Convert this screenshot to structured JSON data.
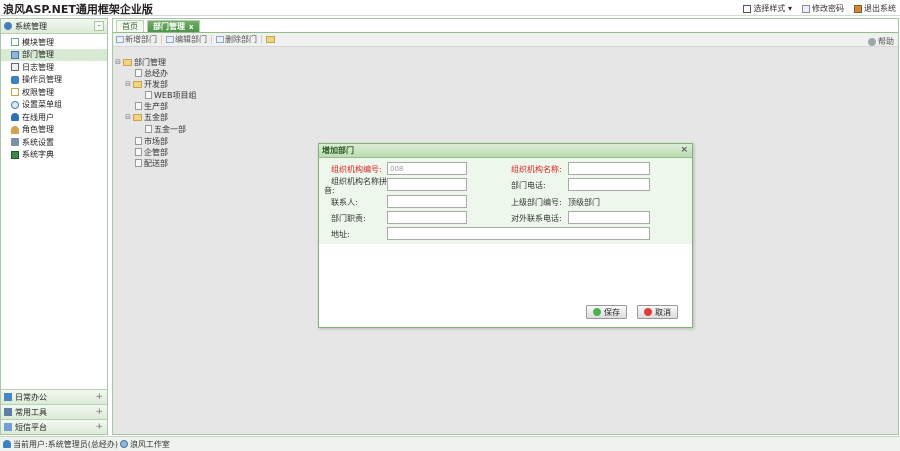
{
  "app": {
    "title": "浪风ASP.NET通用框架企业版"
  },
  "header_links": [
    {
      "label": "选择样式 ▾"
    },
    {
      "label": "修改密码"
    },
    {
      "label": "退出系统"
    }
  ],
  "sidebar": {
    "title": "系统管理",
    "collapse": "–",
    "items": [
      {
        "label": "模块管理"
      },
      {
        "label": "部门管理"
      },
      {
        "label": "日志管理"
      },
      {
        "label": "操作员管理"
      },
      {
        "label": "权限管理"
      },
      {
        "label": "设置菜单组"
      },
      {
        "label": "在线用户"
      },
      {
        "label": "角色管理"
      },
      {
        "label": "系统设置"
      },
      {
        "label": "系统字典"
      }
    ],
    "sections": [
      {
        "label": "日常办公"
      },
      {
        "label": "常用工具"
      },
      {
        "label": "短信平台"
      }
    ]
  },
  "tabs": [
    {
      "label": "首页"
    },
    {
      "label": "部门管理"
    }
  ],
  "tab_close": "x",
  "toolbar": {
    "add": "新增部门",
    "edit": "编辑部门",
    "delete": "删除部门",
    "help": "帮助"
  },
  "tree": {
    "root": "部门管理",
    "nodes": {
      "n1": "总经办",
      "n2": "开发部",
      "n3": "WEB项目组",
      "n4": "生产部",
      "n5": "五金部",
      "n6": "五金一部",
      "n7": "市场部",
      "n8": "企管部",
      "n9": "配送部"
    },
    "expander": "⊟"
  },
  "dialog": {
    "title": "增加部门",
    "close": "×",
    "labels": {
      "org_code": "组织机构编号:",
      "org_name": "组织机构名称:",
      "org_short": "组织机构名称拼",
      "org_short2": "音:",
      "phone": "部门电话:",
      "contact": "联系人:",
      "parent_code": "上级部门编号:",
      "duty": "部门职责:",
      "ext_phone": "对外联系电话:",
      "address": "地址:"
    },
    "values": {
      "org_code": "008",
      "parent_code": "顶级部门"
    },
    "save": "保存",
    "cancel": "取消"
  },
  "status": {
    "user": "当前用户:系统管理员(总经办)",
    "studio": "浪风工作室"
  },
  "colors": {
    "accent": "#4e944a",
    "required": "#dd2222"
  }
}
